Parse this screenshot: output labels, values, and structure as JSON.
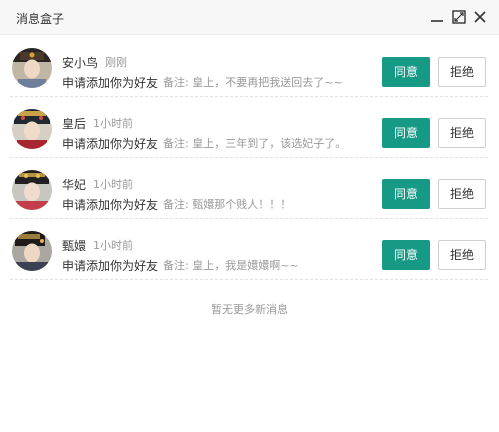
{
  "window": {
    "title": "消息盒子",
    "controls": [
      {
        "icon": "minimize-icon"
      },
      {
        "icon": "maximize-icon"
      },
      {
        "icon": "close-icon"
      }
    ]
  },
  "messages": [
    {
      "name": "安小鸟",
      "time": "刚刚",
      "request": "申请添加你为好友",
      "note": "备注: 皇上，不要再把我送回去了~~",
      "accept_label": "同意",
      "reject_label": "拒绝",
      "avatar": "avatar-an"
    },
    {
      "name": "皇后",
      "time": "1小时前",
      "request": "申请添加你为好友",
      "note": "备注: 皇上，三年到了，该选妃子了。",
      "accept_label": "同意",
      "reject_label": "拒绝",
      "avatar": "avatar-empress"
    },
    {
      "name": "华妃",
      "time": "1小时前",
      "request": "申请添加你为好友",
      "note": "备注: 甄嬛那个贱人！！！",
      "accept_label": "同意",
      "reject_label": "拒绝",
      "avatar": "avatar-huafei"
    },
    {
      "name": "甄嬛",
      "time": "1小时前",
      "request": "申请添加你为好友",
      "note": "备注: 皇上，我是嬛嬛啊~~",
      "accept_label": "同意",
      "reject_label": "拒绝",
      "avatar": "avatar-zhenhuan"
    }
  ],
  "footer": {
    "text": "暂无更多新消息"
  },
  "colors": {
    "accent": "#169a85",
    "muted": "#999999",
    "text": "#333333",
    "border": "#cfcfcf"
  }
}
